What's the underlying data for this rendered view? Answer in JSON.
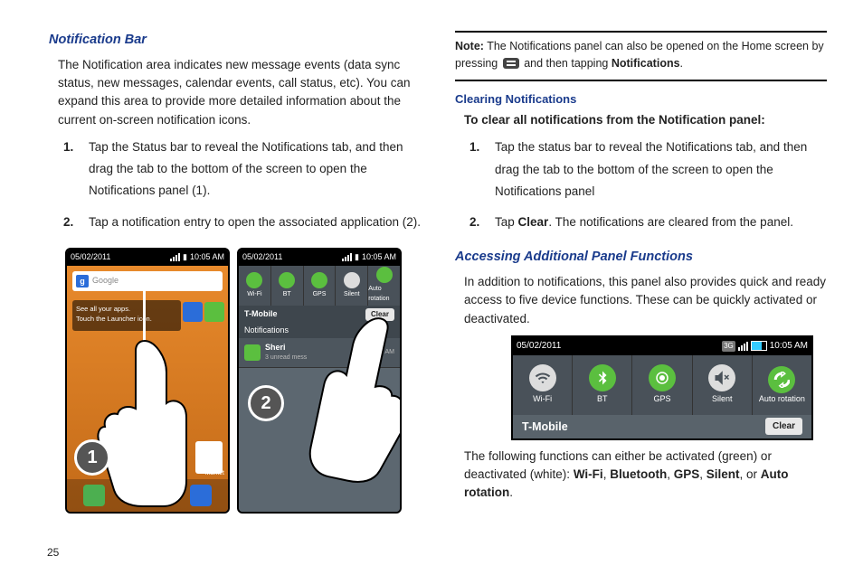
{
  "left": {
    "heading": "Notification Bar",
    "intro": "The Notification area indicates new message events (data sync status, new messages, calendar events, call status, etc). You can expand this area to provide more detailed information about the current on-screen notification icons.",
    "steps": [
      {
        "num": "1.",
        "text": "Tap the Status bar to reveal the Notifications tab, and then drag the tab to the bottom of the screen to open the Notifications panel (1)."
      },
      {
        "num": "2.",
        "text": "Tap a notification entry to open the associated application (2)."
      }
    ],
    "phone_common": {
      "date": "05/02/2011",
      "time": "10:05 AM"
    },
    "home": {
      "search_placeholder": "Google",
      "widget_l1": "See all your apps.",
      "widget_l2": "Touch the Launcher icon.",
      "market_label": "Market",
      "circle": "1"
    },
    "panel": {
      "toggles": [
        {
          "label": "Wi-Fi",
          "on": true
        },
        {
          "label": "BT",
          "on": true
        },
        {
          "label": "GPS",
          "on": true
        },
        {
          "label": "Silent",
          "on": false
        },
        {
          "label": "Auto rotation",
          "on": true
        }
      ],
      "carrier": "T-Mobile",
      "clear": "Clear",
      "noti_header": "Notifications",
      "noti_title": "Sheri",
      "noti_sub": "3 unread mess",
      "noti_time": "9:27 AM",
      "circle": "2"
    }
  },
  "right": {
    "note_label": "Note:",
    "note_a": "The Notifications panel can also be opened on the Home screen by pressing",
    "note_b": "and then tapping",
    "note_bold": "Notifications",
    "clearing_h": "Clearing Notifications",
    "clearing_lead": "To clear all notifications from the Notification panel:",
    "clearing_steps": [
      {
        "num": "1.",
        "text": "Tap the status bar to reveal the Notifications tab, and then drag the tab to the bottom of the screen to open the Notifications panel"
      },
      {
        "num": "2.",
        "pre": "Tap ",
        "bold": "Clear",
        "post": ". The notifications are cleared from the panel."
      }
    ],
    "panelfn_h": "Accessing Additional Panel Functions",
    "panelfn_intro": "In addition to notifications, this panel also provides quick and ready access to five device functions. These can be quickly activated or deactivated.",
    "bigpanel": {
      "date": "05/02/2011",
      "time": "10:05 AM",
      "toggles": [
        {
          "label": "Wi-Fi",
          "on": false
        },
        {
          "label": "BT",
          "on": true
        },
        {
          "label": "GPS",
          "on": true
        },
        {
          "label": "Silent",
          "on": false
        },
        {
          "label": "Auto rotation",
          "on": true
        }
      ],
      "carrier": "T-Mobile",
      "clear": "Clear"
    },
    "following_a": "The following functions can either be activated (green) or deactivated (white): ",
    "fnlist": [
      "Wi-Fi",
      "Bluetooth",
      "GPS",
      "Silent",
      "Auto rotation"
    ],
    "or": ", or "
  },
  "page_number": "25"
}
